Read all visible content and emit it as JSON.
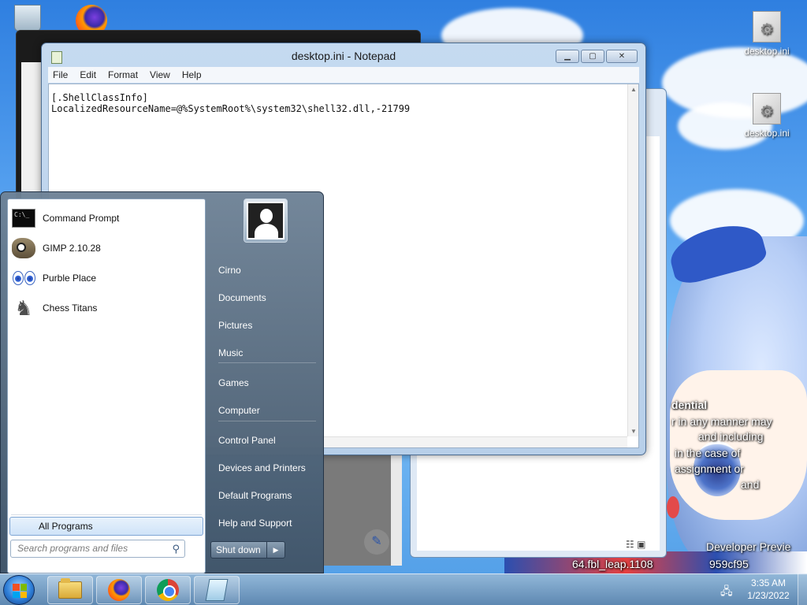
{
  "desktop": {
    "icons": [
      {
        "label": "desktop.ini"
      },
      {
        "label": "desktop.ini"
      }
    ],
    "overlay_lines": [
      "dential",
      "r in any manner may",
      "and including",
      "in the case of",
      "assignment or",
      "and",
      "Developer Previe",
      "64.fbl_leap.1108",
      "959cf95"
    ]
  },
  "notepad": {
    "title": "desktop.ini - Notepad",
    "menu": [
      "File",
      "Edit",
      "Format",
      "View",
      "Help"
    ],
    "content": "[.ShellClassInfo]\nLocalizedResourceName=@%SystemRoot%\\system32\\shell32.dll,-21799"
  },
  "start_menu": {
    "programs": [
      {
        "label": "Command Prompt",
        "icon": "command-prompt-icon"
      },
      {
        "label": "GIMP 2.10.28",
        "icon": "gimp-icon"
      },
      {
        "label": "Purble Place",
        "icon": "purble-place-icon"
      },
      {
        "label": "Chess Titans",
        "icon": "chess-titans-icon"
      }
    ],
    "all_programs": "All Programs",
    "search_placeholder": "Search programs and files",
    "right_links": [
      "Cirno",
      "Documents",
      "Pictures",
      "Music",
      "Games",
      "Computer",
      "Control Panel",
      "Devices and Printers",
      "Default Programs",
      "Help and Support"
    ],
    "shutdown": "Shut down"
  },
  "taskbar": {
    "pinned": [
      "windows-explorer-icon",
      "firefox-icon",
      "chrome-icon",
      "notepad-icon"
    ],
    "time": "3:35 AM",
    "date": "1/23/2022"
  }
}
